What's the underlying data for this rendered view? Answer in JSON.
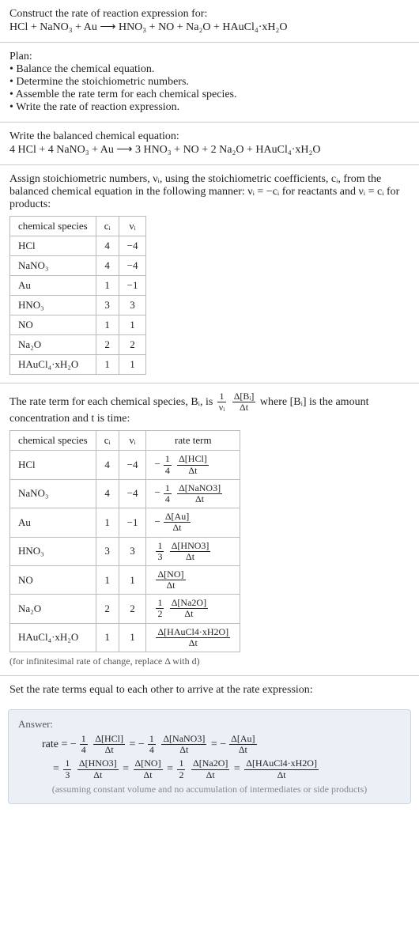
{
  "intro": {
    "line1": "Construct the rate of reaction expression for:",
    "equation_unbalanced": "HCl + NaNO₃ + Au  ⟶  HNO₃ + NO + Na₂O + HAuCl₄·xH₂O"
  },
  "plan": {
    "title": "Plan:",
    "items": [
      "• Balance the chemical equation.",
      "• Determine the stoichiometric numbers.",
      "• Assemble the rate term for each chemical species.",
      "• Write the rate of reaction expression."
    ]
  },
  "balanced": {
    "title": "Write the balanced chemical equation:",
    "equation": "4 HCl + 4 NaNO₃ + Au  ⟶  3 HNO₃ + NO + 2 Na₂O + HAuCl₄·xH₂O"
  },
  "assign": {
    "text1": "Assign stoichiometric numbers, νᵢ, using the stoichiometric coefficients, cᵢ, from the balanced chemical equation in the following manner: νᵢ = −cᵢ for reactants and νᵢ = cᵢ for products:",
    "headers": {
      "species": "chemical species",
      "ci": "cᵢ",
      "vi": "νᵢ"
    },
    "rows": [
      {
        "species": "HCl",
        "ci": "4",
        "vi": "−4"
      },
      {
        "species": "NaNO₃",
        "ci": "4",
        "vi": "−4"
      },
      {
        "species": "Au",
        "ci": "1",
        "vi": "−1"
      },
      {
        "species": "HNO₃",
        "ci": "3",
        "vi": "3"
      },
      {
        "species": "NO",
        "ci": "1",
        "vi": "1"
      },
      {
        "species": "Na₂O",
        "ci": "2",
        "vi": "2"
      },
      {
        "species": "HAuCl₄·xH₂O",
        "ci": "1",
        "vi": "1"
      }
    ]
  },
  "rate_term_intro": {
    "pre": "The rate term for each chemical species, Bᵢ, is ",
    "post": " where [Bᵢ] is the amount concentration and t is time:",
    "frac1_num": "1",
    "frac1_den": "νᵢ",
    "frac2_num": "Δ[Bᵢ]",
    "frac2_den": "Δt"
  },
  "rate_table": {
    "headers": {
      "species": "chemical species",
      "ci": "cᵢ",
      "vi": "νᵢ",
      "term": "rate term"
    },
    "rows": [
      {
        "species": "HCl",
        "ci": "4",
        "vi": "−4",
        "neg": true,
        "coef_num": "1",
        "coef_den": "4",
        "conc_num": "Δ[HCl]",
        "conc_den": "Δt"
      },
      {
        "species": "NaNO₃",
        "ci": "4",
        "vi": "−4",
        "neg": true,
        "coef_num": "1",
        "coef_den": "4",
        "conc_num": "Δ[NaNO3]",
        "conc_den": "Δt"
      },
      {
        "species": "Au",
        "ci": "1",
        "vi": "−1",
        "neg": true,
        "coef_num": "",
        "coef_den": "",
        "conc_num": "Δ[Au]",
        "conc_den": "Δt"
      },
      {
        "species": "HNO₃",
        "ci": "3",
        "vi": "3",
        "neg": false,
        "coef_num": "1",
        "coef_den": "3",
        "conc_num": "Δ[HNO3]",
        "conc_den": "Δt"
      },
      {
        "species": "NO",
        "ci": "1",
        "vi": "1",
        "neg": false,
        "coef_num": "",
        "coef_den": "",
        "conc_num": "Δ[NO]",
        "conc_den": "Δt"
      },
      {
        "species": "Na₂O",
        "ci": "2",
        "vi": "2",
        "neg": false,
        "coef_num": "1",
        "coef_den": "2",
        "conc_num": "Δ[Na2O]",
        "conc_den": "Δt"
      },
      {
        "species": "HAuCl₄·xH₂O",
        "ci": "1",
        "vi": "1",
        "neg": false,
        "coef_num": "",
        "coef_den": "",
        "conc_num": "Δ[HAuCl4·xH2O]",
        "conc_den": "Δt"
      }
    ],
    "footnote": "(for infinitesimal rate of change, replace Δ with d)"
  },
  "set_equal": "Set the rate terms equal to each other to arrive at the rate expression:",
  "answer": {
    "label": "Answer:",
    "rate_label": "rate = ",
    "eq": " = ",
    "terms": [
      {
        "neg": true,
        "coef_num": "1",
        "coef_den": "4",
        "conc_num": "Δ[HCl]",
        "conc_den": "Δt"
      },
      {
        "neg": true,
        "coef_num": "1",
        "coef_den": "4",
        "conc_num": "Δ[NaNO3]",
        "conc_den": "Δt"
      },
      {
        "neg": true,
        "coef_num": "",
        "coef_den": "",
        "conc_num": "Δ[Au]",
        "conc_den": "Δt"
      },
      {
        "neg": false,
        "coef_num": "1",
        "coef_den": "3",
        "conc_num": "Δ[HNO3]",
        "conc_den": "Δt"
      },
      {
        "neg": false,
        "coef_num": "",
        "coef_den": "",
        "conc_num": "Δ[NO]",
        "conc_den": "Δt"
      },
      {
        "neg": false,
        "coef_num": "1",
        "coef_den": "2",
        "conc_num": "Δ[Na2O]",
        "conc_den": "Δt"
      },
      {
        "neg": false,
        "coef_num": "",
        "coef_den": "",
        "conc_num": "Δ[HAuCl4·xH2O]",
        "conc_den": "Δt"
      }
    ],
    "assumption": "(assuming constant volume and no accumulation of intermediates or side products)"
  },
  "chart_data": {
    "type": "table",
    "title": "Stoichiometric numbers and rate terms",
    "columns": [
      "chemical species",
      "cᵢ",
      "νᵢ",
      "rate term"
    ],
    "rows": [
      [
        "HCl",
        4,
        -4,
        "-(1/4) Δ[HCl]/Δt"
      ],
      [
        "NaNO₃",
        4,
        -4,
        "-(1/4) Δ[NaNO3]/Δt"
      ],
      [
        "Au",
        1,
        -1,
        "- Δ[Au]/Δt"
      ],
      [
        "HNO₃",
        3,
        3,
        "(1/3) Δ[HNO3]/Δt"
      ],
      [
        "NO",
        1,
        1,
        "Δ[NO]/Δt"
      ],
      [
        "Na₂O",
        2,
        2,
        "(1/2) Δ[Na2O]/Δt"
      ],
      [
        "HAuCl₄·xH₂O",
        1,
        1,
        "Δ[HAuCl4·xH2O]/Δt"
      ]
    ]
  }
}
